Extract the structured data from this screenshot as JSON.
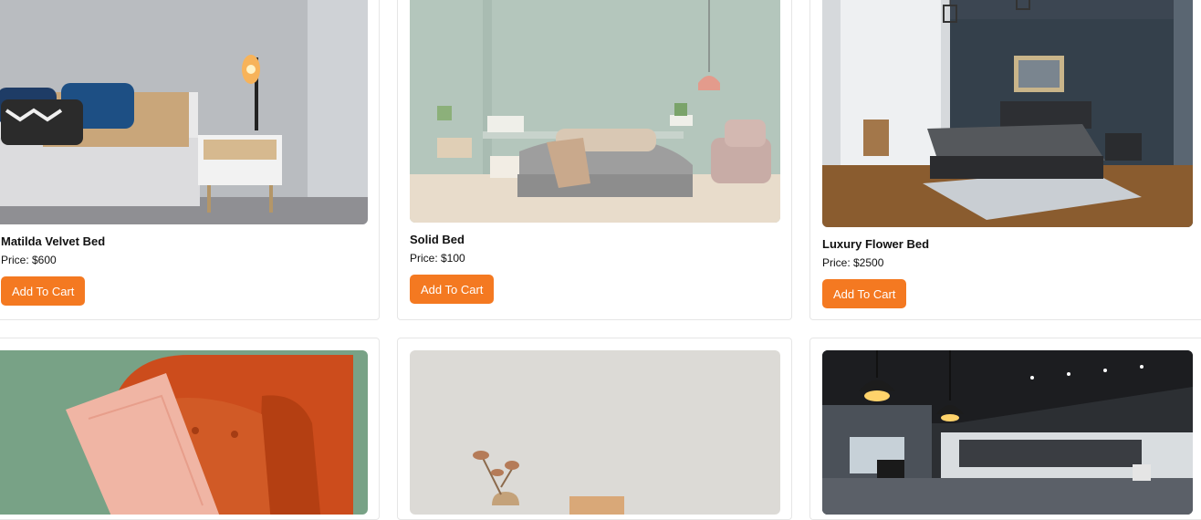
{
  "products": [
    {
      "name": "Matilda Velvet Bed",
      "price": "Price: $600",
      "button": "Add To Cart",
      "image": "bedroom-with-lamp-photo"
    },
    {
      "name": "Solid Bed",
      "price": "Price: $100",
      "button": "Add To Cart",
      "image": "sage-bedroom-photo"
    },
    {
      "name": "Luxury Flower Bed",
      "price": "Price: $2500",
      "button": "Add To Cart",
      "image": "dark-bedroom-photo"
    },
    {
      "name": "",
      "price": "",
      "button": "",
      "image": "orange-sofa-photo"
    },
    {
      "name": "",
      "price": "",
      "button": "",
      "image": "minimal-vase-photo"
    },
    {
      "name": "",
      "price": "",
      "button": "",
      "image": "office-interior-photo"
    }
  ],
  "colors": {
    "accent": "#f47921",
    "border": "#e6e6e6"
  }
}
